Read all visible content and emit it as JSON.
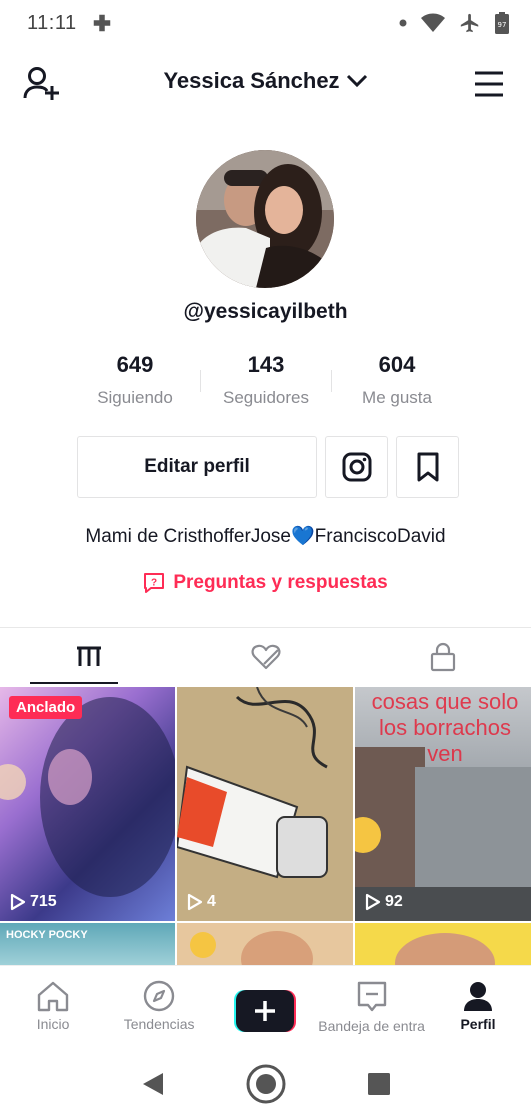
{
  "status": {
    "time": "11:11",
    "battery": "97"
  },
  "header": {
    "profile_name": "Yessica Sánchez"
  },
  "profile": {
    "username": "@yessicayilbeth",
    "stats": [
      {
        "value": "649",
        "label": "Siguiendo"
      },
      {
        "value": "143",
        "label": "Seguidores"
      },
      {
        "value": "604",
        "label": "Me gusta"
      }
    ],
    "edit_label": "Editar perfil",
    "bio_before": "Mami de CristhofferJose",
    "bio_heart": "💙",
    "bio_after": "FranciscoDavid",
    "qa_label": "Preguntas y respuestas"
  },
  "grid": {
    "pinned_label": "Anclado",
    "videos": [
      {
        "views": "715"
      },
      {
        "views": "4"
      },
      {
        "views": "92",
        "overlay": "cosas que solo los borrachos ven"
      },
      {
        "overlay": "HOCKY POCKY"
      }
    ]
  },
  "bottom_nav": {
    "items": [
      {
        "label": "Inicio"
      },
      {
        "label": "Tendencias"
      },
      {
        "label": ""
      },
      {
        "label": "Bandeja de entra"
      },
      {
        "label": "Perfil"
      }
    ]
  },
  "colors": {
    "accent": "#fe2c55",
    "text": "#161823",
    "muted": "#8a8b91"
  }
}
